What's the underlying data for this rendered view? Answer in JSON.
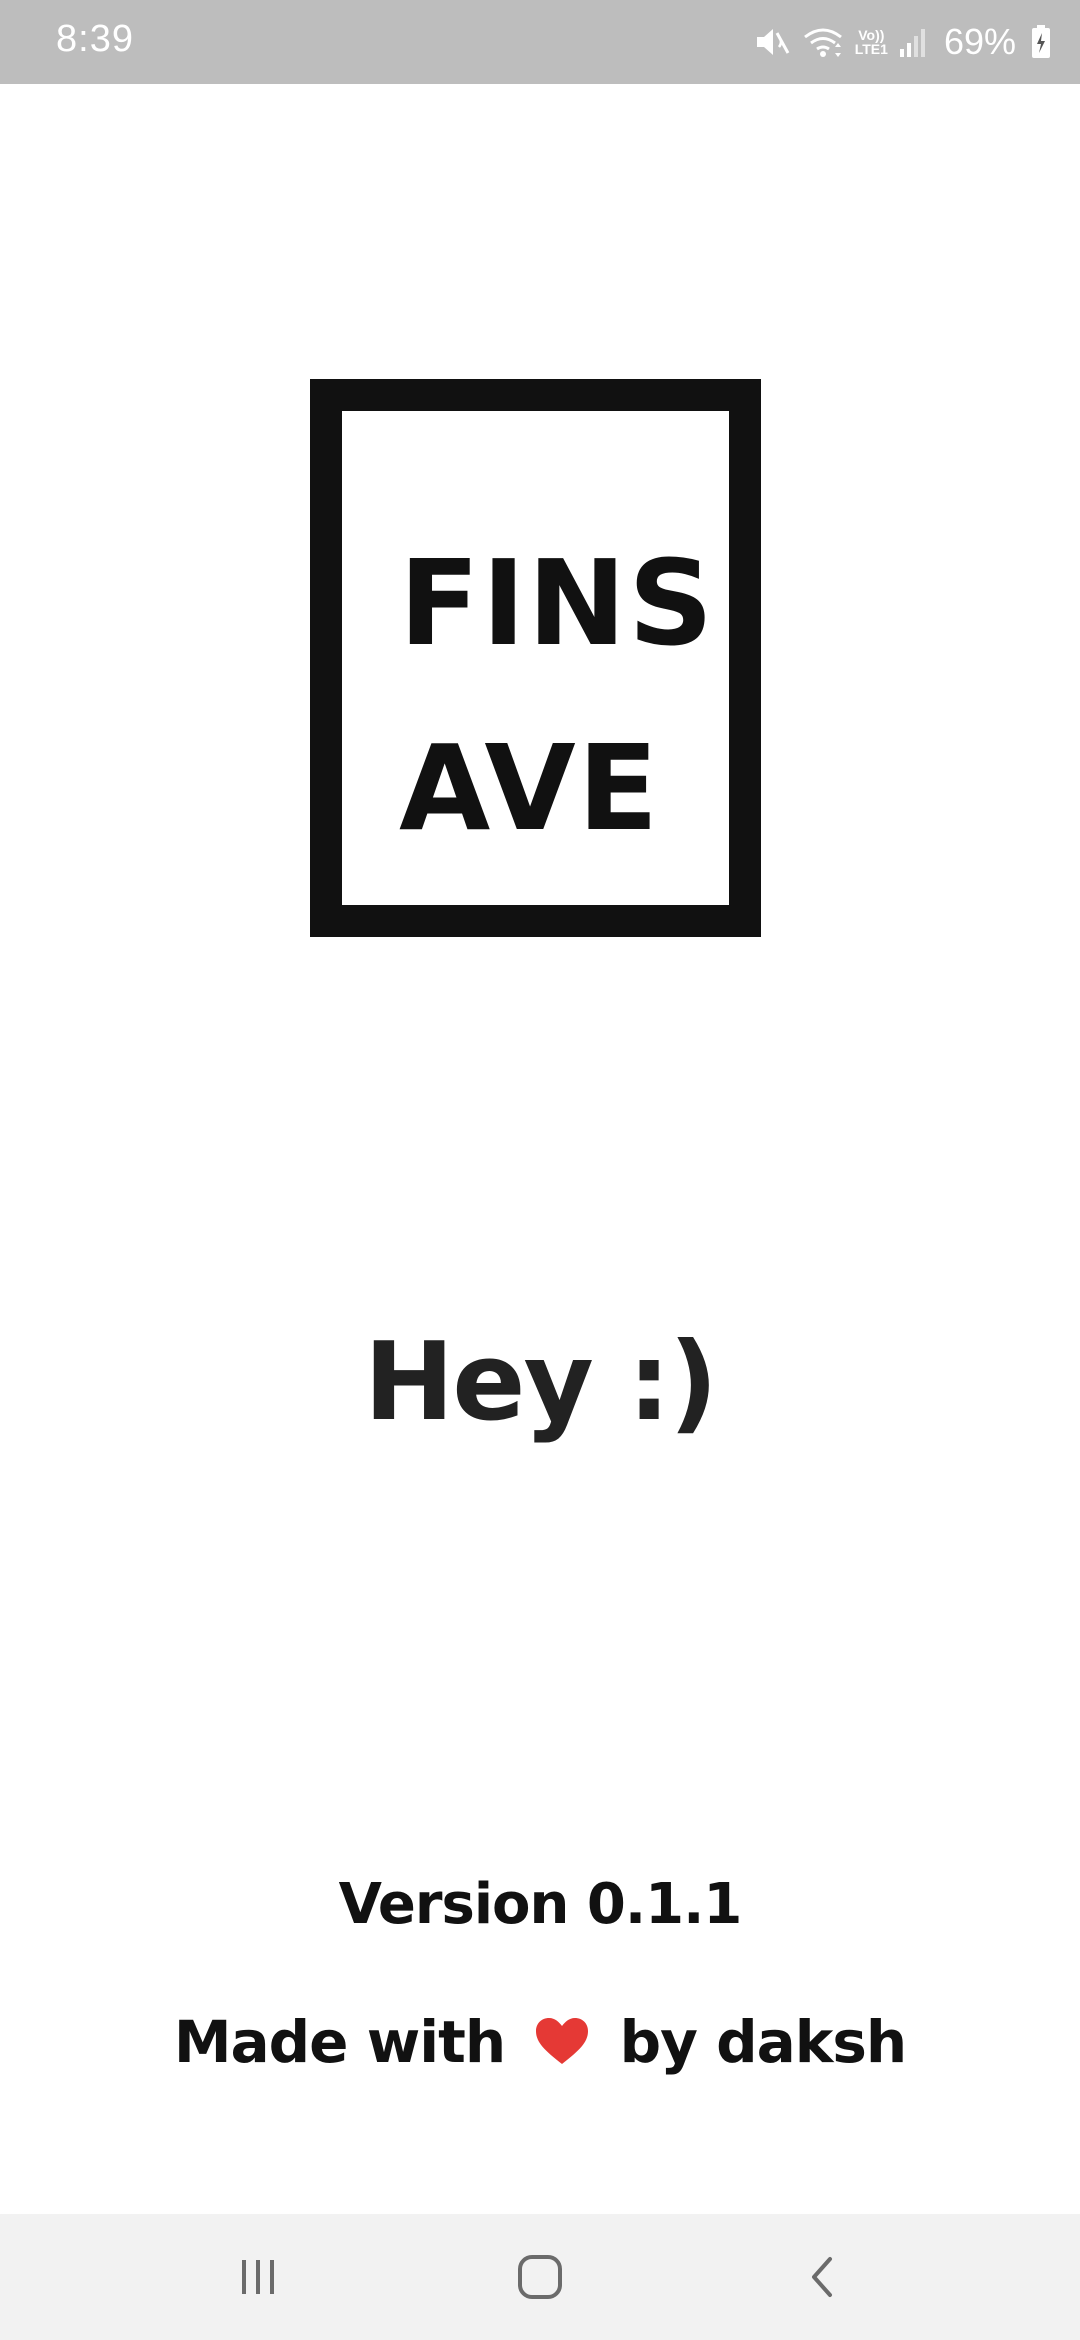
{
  "status_bar": {
    "time": "8:39",
    "battery_percent": "69%",
    "icons": [
      "mute-icon",
      "wifi-icon",
      "volte-lte-icon",
      "signal-icon",
      "battery-charging-icon"
    ],
    "volte_label": "Vo))",
    "lte_label": "LTE1"
  },
  "logo": {
    "line1": "FINS",
    "line2": "AVE"
  },
  "greeting": "Hey :)",
  "version": "Version 0.1.1",
  "credits": {
    "prefix": "Made with",
    "heart_color": "#e53935",
    "suffix": "by daksh"
  },
  "nav_bar": {
    "buttons": [
      "recents-icon",
      "home-icon",
      "back-icon"
    ]
  }
}
